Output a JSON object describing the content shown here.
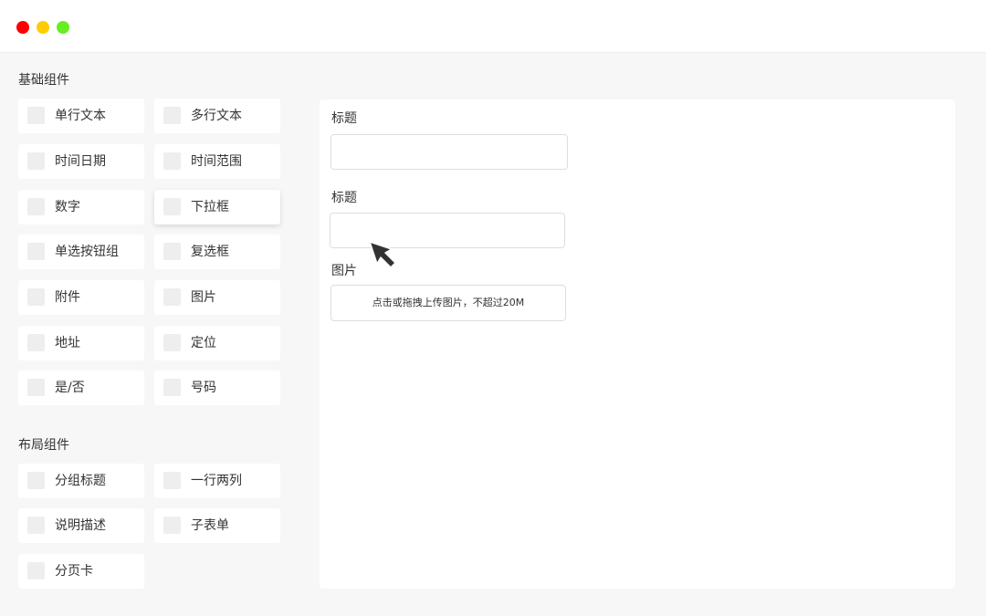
{
  "window": {
    "controls": [
      "close",
      "minimize",
      "maximize"
    ]
  },
  "basic": {
    "title": "基础组件",
    "items": [
      {
        "label": "单行文本"
      },
      {
        "label": "多行文本"
      },
      {
        "label": "时间日期"
      },
      {
        "label": "时间范围"
      },
      {
        "label": "数字"
      },
      {
        "label": "下拉框"
      },
      {
        "label": "单选按钮组"
      },
      {
        "label": "复选框"
      },
      {
        "label": "附件"
      },
      {
        "label": "图片"
      },
      {
        "label": "地址"
      },
      {
        "label": "定位"
      },
      {
        "label": "是/否"
      },
      {
        "label": "号码"
      }
    ]
  },
  "layout": {
    "title": "布局组件",
    "items": [
      {
        "label": "分组标题"
      },
      {
        "label": "一行两列"
      },
      {
        "label": "说明描述"
      },
      {
        "label": "子表单"
      },
      {
        "label": "分页卡"
      }
    ]
  },
  "form": {
    "field1_label": "标题",
    "field2_label": "标题",
    "image_label": "图片",
    "upload_hint": "点击或拖拽上传图片，不超过20M"
  },
  "colors": {
    "close": "#ff0000",
    "minimize": "#ffcc00",
    "maximize": "#66ee22",
    "background": "#f7f7f7",
    "icon_placeholder": "#eeeeee"
  },
  "icons": {
    "component_icon": "placeholder-square-icon",
    "cursor": "arrow-cursor-icon"
  }
}
